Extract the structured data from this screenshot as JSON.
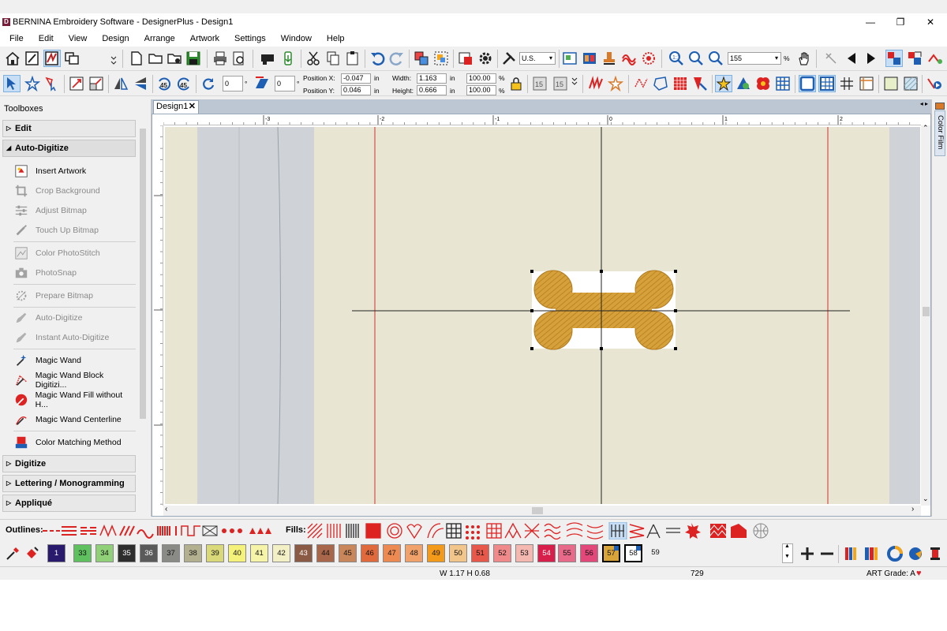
{
  "window": {
    "title": "BERNINA Embroidery Software - DesignerPlus - Design1",
    "logo": "D"
  },
  "menu": [
    "File",
    "Edit",
    "View",
    "Design",
    "Arrange",
    "Artwork",
    "Settings",
    "Window",
    "Help"
  ],
  "toolbar": {
    "units": "U.S.",
    "zoom": "155",
    "zoom_unit": "%",
    "rotate_value": "0",
    "slant_value": "0",
    "pos_x_label": "Position X:",
    "pos_x": "-0.047",
    "pos_y_label": "Position Y:",
    "pos_y": "0.046",
    "width_label": "Width:",
    "width": "1.163",
    "height_label": "Height:",
    "height": "0.666",
    "unit_in": "in",
    "scale_w": "100.00",
    "scale_h": "100.00",
    "pct": "%"
  },
  "toolboxes": {
    "header": "Toolboxes",
    "sections": {
      "edit": "Edit",
      "auto_digitize": "Auto-Digitize",
      "digitize": "Digitize",
      "lettering": "Lettering / Monogramming",
      "applique": "Appliqué"
    },
    "items": [
      {
        "label": "Insert Artwork",
        "icon": "insert-artwork-icon",
        "disabled": false
      },
      {
        "label": "Crop Background",
        "icon": "crop-icon",
        "disabled": true
      },
      {
        "label": "Adjust Bitmap",
        "icon": "sliders-icon",
        "disabled": true
      },
      {
        "label": "Touch Up Bitmap",
        "icon": "brush-icon",
        "disabled": true
      },
      {
        "label": "Color PhotoStitch",
        "icon": "photostitch-icon",
        "disabled": true
      },
      {
        "label": "PhotoSnap",
        "icon": "camera-icon",
        "disabled": true
      },
      {
        "label": "Prepare Bitmap",
        "icon": "prepare-bitmap-icon",
        "disabled": true
      },
      {
        "label": "Auto-Digitize",
        "icon": "auto-digitize-icon",
        "disabled": true
      },
      {
        "label": "Instant Auto-Digitize",
        "icon": "instant-auto-digitize-icon",
        "disabled": true
      },
      {
        "label": "Magic Wand",
        "icon": "magic-wand-icon",
        "disabled": false
      },
      {
        "label": "Magic Wand Block Digitizi...",
        "icon": "magic-wand-block-icon",
        "disabled": false
      },
      {
        "label": "Magic Wand Fill without H...",
        "icon": "magic-wand-fill-icon",
        "disabled": false
      },
      {
        "label": "Magic Wand Centerline",
        "icon": "magic-wand-centerline-icon",
        "disabled": false
      },
      {
        "label": "Color Matching Method",
        "icon": "color-matching-icon",
        "disabled": false
      }
    ]
  },
  "document": {
    "tab": "Design1",
    "ruler_labels": [
      "-3",
      "-2",
      "-1",
      "0",
      "1",
      "2"
    ],
    "design": "bone-embroidery",
    "thread_color": "#d9a53a"
  },
  "right_pane": {
    "tab": "Color Film"
  },
  "stitchbar": {
    "outlines_label": "Outlines:",
    "fills_label": "Fills:"
  },
  "colors": {
    "swatches": [
      {
        "n": "1",
        "c": "#2a1a6e"
      },
      {
        "n": "33",
        "c": "#5fc05f"
      },
      {
        "n": "34",
        "c": "#8fd079"
      },
      {
        "n": "35",
        "c": "#2e2e2e"
      },
      {
        "n": "36",
        "c": "#5a5a5a"
      },
      {
        "n": "37",
        "c": "#8a8a86"
      },
      {
        "n": "38",
        "c": "#b3b090"
      },
      {
        "n": "39",
        "c": "#d9d97a"
      },
      {
        "n": "40",
        "c": "#f4f27a"
      },
      {
        "n": "41",
        "c": "#f6f4a8"
      },
      {
        "n": "42",
        "c": "#f3f0c6"
      },
      {
        "n": "43",
        "c": "#8a5a44"
      },
      {
        "n": "44",
        "c": "#a8674a"
      },
      {
        "n": "45",
        "c": "#c9865a"
      },
      {
        "n": "46",
        "c": "#e06a3c"
      },
      {
        "n": "47",
        "c": "#ec8a52"
      },
      {
        "n": "48",
        "c": "#f0a26a"
      },
      {
        "n": "49",
        "c": "#f49a1a"
      },
      {
        "n": "50",
        "c": "#f2c68a"
      },
      {
        "n": "51",
        "c": "#e8584a"
      },
      {
        "n": "52",
        "c": "#f08a8a"
      },
      {
        "n": "53",
        "c": "#f4b8b0"
      },
      {
        "n": "54",
        "c": "#d81e4a"
      },
      {
        "n": "55",
        "c": "#e86a8a"
      },
      {
        "n": "56",
        "c": "#e2487a"
      },
      {
        "n": "57",
        "c": "#d9a53a"
      },
      {
        "n": "58",
        "c": "#ffffff"
      },
      {
        "n": "59",
        "c": "#f0f0f0"
      }
    ]
  },
  "status": {
    "size": "W 1.17 H 0.68",
    "stitches": "729",
    "grade": "ART Grade: A",
    "heart": "♥"
  }
}
